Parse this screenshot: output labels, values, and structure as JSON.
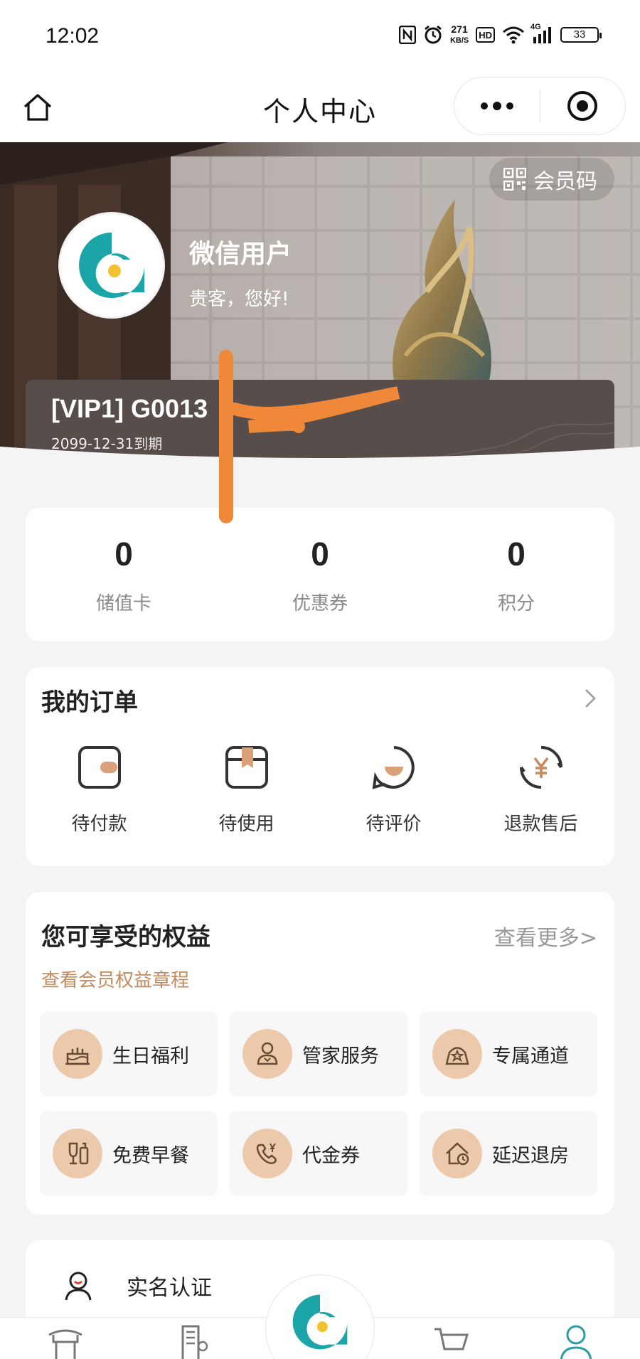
{
  "status_bar": {
    "time": "12:02",
    "net_speed_value": "271",
    "net_speed_unit": "KB/S",
    "hd_label": "HD",
    "network_label": "4G",
    "battery": "33"
  },
  "nav": {
    "title": "个人中心",
    "more_icon": "more-dots-icon",
    "close_icon": "target-icon"
  },
  "hero": {
    "member_code_label": "会员码",
    "username": "微信用户",
    "greeting": "贵客，您好!",
    "vip_level": "[VIP1] G0013",
    "vip_expire": "2099-12-31到期"
  },
  "stats": [
    {
      "value": "0",
      "label": "储值卡"
    },
    {
      "value": "0",
      "label": "优惠券"
    },
    {
      "value": "0",
      "label": "积分"
    }
  ],
  "orders": {
    "title": "我的订单",
    "items": [
      {
        "label": "待付款",
        "icon": "wallet-icon"
      },
      {
        "label": "待使用",
        "icon": "bookmark-box-icon"
      },
      {
        "label": "待评价",
        "icon": "chat-bubble-icon"
      },
      {
        "label": "退款售后",
        "icon": "yen-refund-icon"
      }
    ]
  },
  "benefits": {
    "title": "您可享受的权益",
    "more": "查看更多>",
    "link": "查看会员权益章程",
    "items": [
      {
        "label": "生日福利",
        "icon": "cake-icon"
      },
      {
        "label": "管家服务",
        "icon": "butler-icon"
      },
      {
        "label": "专属通道",
        "icon": "vip-channel-icon"
      },
      {
        "label": "免费早餐",
        "icon": "breakfast-icon"
      },
      {
        "label": "代金券",
        "icon": "voucher-icon"
      },
      {
        "label": "延迟退房",
        "icon": "late-checkout-icon"
      }
    ]
  },
  "verify": {
    "label": "实名认证"
  },
  "colors": {
    "accent": "#c38a5e",
    "benefit_icon_bg": "#ecc9ab",
    "logo_teal": "#1ba5a8",
    "logo_yellow": "#f2c230",
    "vip_card": "#574e4c",
    "scribble": "#f0883a"
  }
}
